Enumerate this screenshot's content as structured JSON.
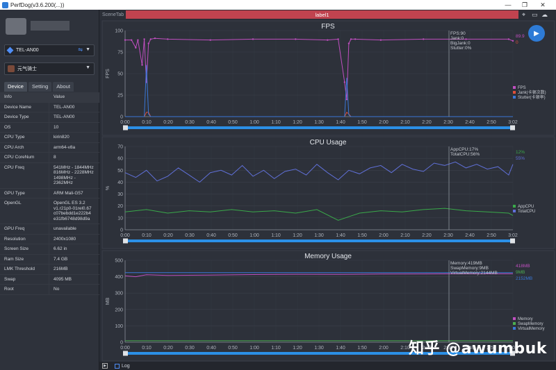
{
  "window": {
    "title": "PerfDog(v3.6.200(...))",
    "min": "—",
    "max": "❐",
    "close": "✕"
  },
  "sidebar": {
    "device": "TEL-AN00",
    "app": "元气骑士",
    "tabs": [
      "Device",
      "Setting",
      "About"
    ],
    "table_header": {
      "key": "Info",
      "value": "Value"
    },
    "rows": [
      {
        "k": "Device Name",
        "v": "TEL-AN00"
      },
      {
        "k": "Device Type",
        "v": "TEL-AN00"
      },
      {
        "k": "OS",
        "v": "10"
      },
      {
        "k": "CPU Type",
        "v": "kirin820"
      },
      {
        "k": "CPU Arch",
        "v": "arm64-v8a"
      },
      {
        "k": "CPU CoreNum",
        "v": "8"
      },
      {
        "k": "CPU Freq",
        "v": "541MHz - 1844MHz\n816MHz - 2228MHz\n1498MHz -\n2362MHz"
      },
      {
        "k": "GPU Type",
        "v": "ARM Mali-G57"
      },
      {
        "k": "OpenGL",
        "v": "OpenGL ES 3.2\nv1.r21p0-01rel0.67\nc07bebdd1e222b4\ne31fb6748d98d9a"
      },
      {
        "k": "GPU Freq",
        "v": "unavailable"
      },
      {
        "k": "Resolution",
        "v": "2400x1080"
      },
      {
        "k": "Screen Size",
        "v": "6.62 in"
      },
      {
        "k": "Ram Size",
        "v": "7.4 GB"
      },
      {
        "k": "LMK Threshold",
        "v": "216MB"
      },
      {
        "k": "Swap",
        "v": "4095 MB"
      },
      {
        "k": "Root",
        "v": "No"
      }
    ]
  },
  "scenebar": {
    "tab_label": "SceneTab",
    "label": "label1",
    "icons": [
      "location-icon",
      "folder-icon",
      "cloud-icon"
    ]
  },
  "bottombar": {
    "log": "Log"
  },
  "watermark": "知乎 @awumbuk",
  "colors": {
    "fps": "#c04fc0",
    "jank": "#e0503a",
    "stutter": "#3a78d8",
    "appcpu": "#3aaa4a",
    "totalcpu": "#6070d8",
    "memory": "#c04fc0",
    "swap": "#4caf50",
    "virtual": "#3a78d8",
    "accent": "#2e7bd6",
    "label_bar": "#c0434f"
  },
  "chart_data": [
    {
      "type": "line",
      "title": "FPS",
      "ylabel": "FPS",
      "ylim": [
        0,
        100
      ],
      "yticks": [
        "0",
        "25",
        "50",
        "75",
        "100"
      ],
      "xticks": [
        "0:00",
        "0:10",
        "0:20",
        "0:30",
        "0:40",
        "0:50",
        "1:00",
        "1:10",
        "1:20",
        "1:30",
        "1:40",
        "1:50",
        "2:00",
        "2:10",
        "2:20",
        "2:30",
        "2:40",
        "2:50",
        "3:02"
      ],
      "cursor_text": [
        "FPS:90",
        "Jank:0",
        "BigJank:0",
        "Stutter:0%"
      ],
      "right_values": [
        {
          "text": "89.9",
          "color": "#c04fc0"
        },
        {
          "text": "0",
          "color": "#e0503a"
        }
      ],
      "legend": [
        "FPS",
        "Jank(卡顿次数)",
        "Stutter(卡顿率)"
      ],
      "cursor_x_sec": 152,
      "series": [
        {
          "name": "FPS",
          "x": [
            0,
            3,
            5,
            6,
            8,
            9,
            10,
            11,
            12,
            14,
            20,
            40,
            60,
            80,
            95,
            100,
            103,
            104,
            105,
            106,
            108,
            120,
            140,
            160,
            180,
            182
          ],
          "values": [
            89,
            89,
            80,
            89,
            60,
            90,
            40,
            85,
            90,
            91,
            90,
            89,
            90,
            90,
            89,
            90,
            40,
            20,
            85,
            90,
            90,
            89,
            90,
            90,
            90,
            88
          ]
        },
        {
          "name": "Jank(卡顿次数)",
          "x": [
            0,
            9,
            10,
            11,
            12,
            103,
            104,
            105,
            106,
            182
          ],
          "values": [
            0,
            0,
            5,
            5,
            0,
            0,
            5,
            3,
            0,
            0
          ]
        },
        {
          "name": "Stutter(卡顿率)",
          "x": [
            0,
            9,
            10,
            11,
            12,
            103,
            104,
            105,
            106,
            182
          ],
          "values": [
            0,
            0,
            60,
            3,
            0,
            0,
            45,
            2,
            0,
            0
          ]
        }
      ]
    },
    {
      "type": "line",
      "title": "CPU Usage",
      "ylabel": "%",
      "ylim": [
        0,
        70
      ],
      "yticks": [
        "0",
        "10",
        "20",
        "30",
        "40",
        "50",
        "60",
        "70"
      ],
      "xticks": [
        "0:00",
        "0:10",
        "0:20",
        "0:30",
        "0:40",
        "0:50",
        "1:00",
        "1:10",
        "1:20",
        "1:30",
        "1:40",
        "1:50",
        "2:00",
        "2:10",
        "2:20",
        "2:30",
        "2:40",
        "2:50",
        "3:02"
      ],
      "cursor_text": [
        "AppCPU:17%",
        "TotalCPU:56%"
      ],
      "right_values": [
        {
          "text": "12%",
          "color": "#3aaa4a"
        },
        {
          "text": "55%",
          "color": "#6070d8"
        }
      ],
      "legend": [
        "AppCPU",
        "TotalCPU"
      ],
      "cursor_x_sec": 152,
      "series": [
        {
          "name": "AppCPU",
          "x": [
            0,
            10,
            20,
            30,
            40,
            50,
            60,
            70,
            80,
            90,
            100,
            110,
            120,
            130,
            140,
            150,
            160,
            170,
            180,
            182
          ],
          "values": [
            15,
            17,
            14,
            16,
            15,
            17,
            15,
            16,
            14,
            17,
            8,
            14,
            16,
            15,
            17,
            18,
            16,
            15,
            14,
            12
          ]
        },
        {
          "name": "TotalCPU",
          "x": [
            0,
            5,
            10,
            15,
            20,
            25,
            30,
            35,
            40,
            45,
            50,
            55,
            60,
            65,
            70,
            75,
            80,
            85,
            90,
            95,
            100,
            105,
            110,
            115,
            120,
            125,
            130,
            135,
            140,
            145,
            150,
            155,
            160,
            165,
            170,
            175,
            180,
            182
          ],
          "values": [
            48,
            44,
            50,
            41,
            45,
            52,
            46,
            40,
            48,
            50,
            46,
            54,
            45,
            50,
            43,
            49,
            51,
            46,
            55,
            48,
            42,
            50,
            47,
            52,
            54,
            48,
            55,
            51,
            49,
            56,
            54,
            57,
            52,
            55,
            51,
            53,
            46,
            55
          ]
        }
      ]
    },
    {
      "type": "line",
      "title": "Memory Usage",
      "ylabel": "MB",
      "ylim": [
        0,
        500
      ],
      "yticks": [
        "0",
        "100",
        "200",
        "300",
        "400",
        "500"
      ],
      "xticks": [
        "0:00",
        "0:10",
        "0:20",
        "0:30",
        "0:40",
        "0:50",
        "1:00",
        "1:10",
        "1:20",
        "1:30",
        "1:40",
        "1:50",
        "2:00",
        "2:10",
        "2:20",
        "2:30",
        "2:40",
        "2:50",
        "3:02"
      ],
      "cursor_text": [
        "Memory:419MB",
        "SwapMemory:9MB",
        "VirtualMemory:2144MB"
      ],
      "right_values": [
        {
          "text": "418MB",
          "color": "#c04fc0"
        },
        {
          "text": "9MB",
          "color": "#4caf50"
        },
        {
          "text": "2152MB",
          "color": "#3a78d8"
        }
      ],
      "legend": [
        "Memory",
        "SwapMemory",
        "VirtualMemory"
      ],
      "cursor_x_sec": 152,
      "series": [
        {
          "name": "Memory",
          "x": [
            0,
            5,
            10,
            20,
            40,
            60,
            80,
            100,
            120,
            140,
            160,
            180,
            182
          ],
          "values": [
            405,
            400,
            412,
            408,
            410,
            413,
            415,
            414,
            416,
            417,
            418,
            418,
            418
          ]
        },
        {
          "name": "SwapMemory",
          "x": [
            0,
            182
          ],
          "values": [
            9,
            9
          ]
        },
        {
          "name": "VirtualMemory",
          "x": [
            0,
            182
          ],
          "values": [
            425,
            425
          ]
        }
      ]
    }
  ]
}
